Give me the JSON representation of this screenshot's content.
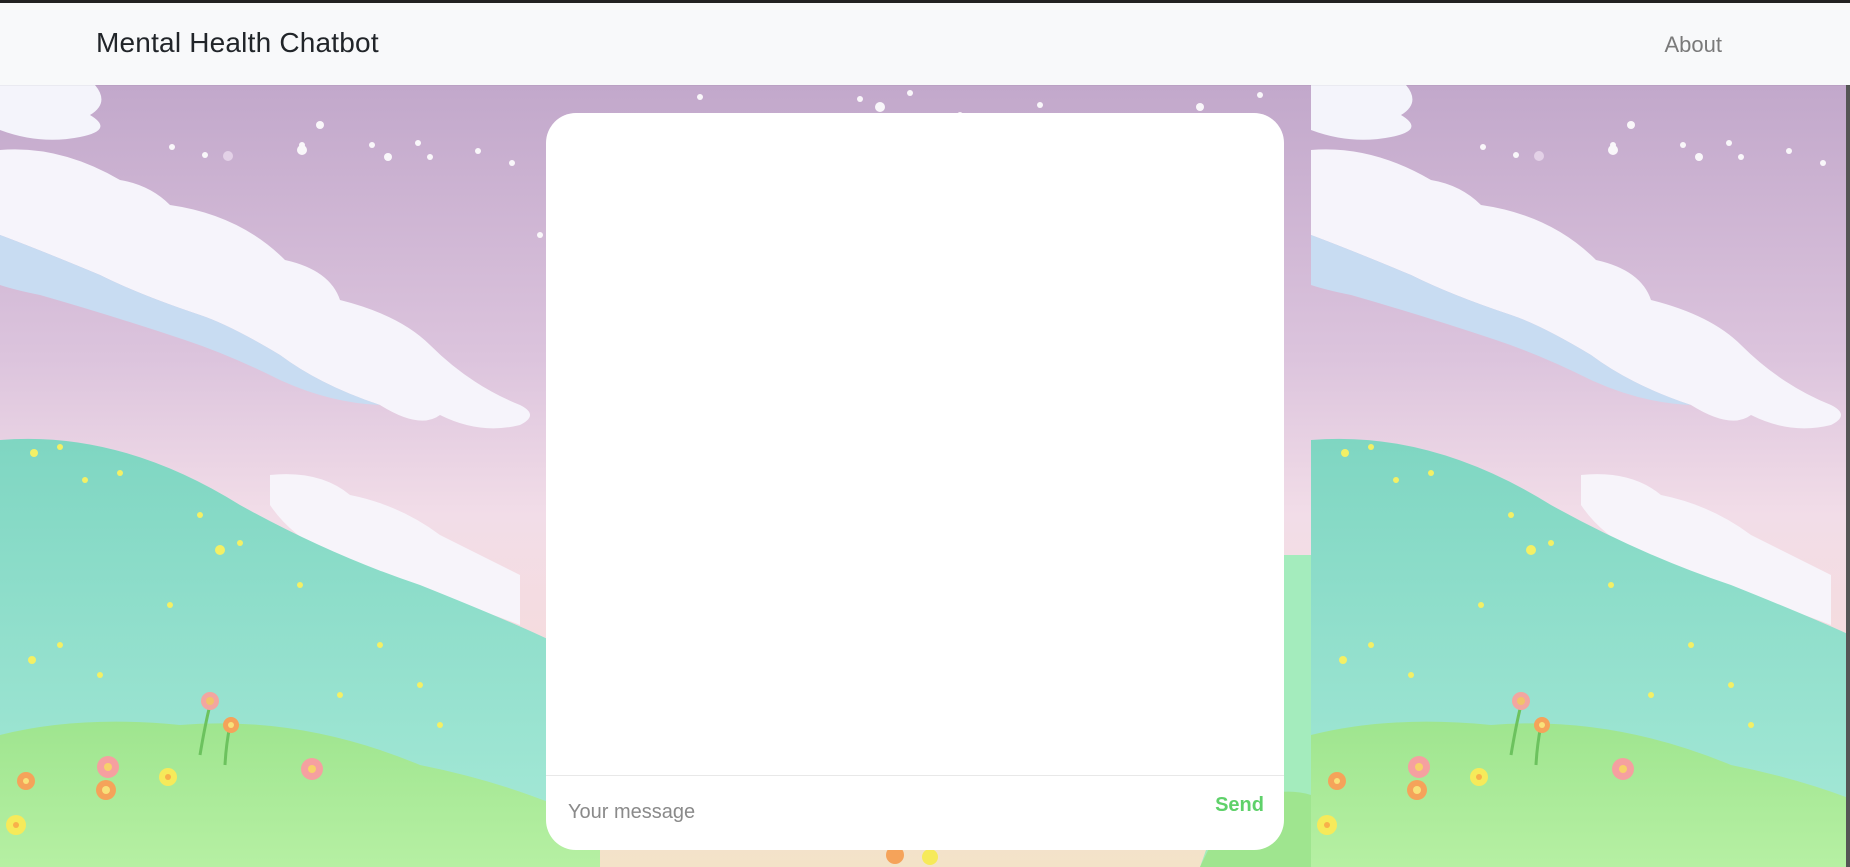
{
  "navbar": {
    "brand": "Mental Health Chatbot",
    "about_link": "About"
  },
  "chat": {
    "input_placeholder": "Your message",
    "input_value": "",
    "send_label": "Send",
    "send_color": "#5fd16a"
  },
  "colors": {
    "navbar_bg": "#f8f9fa",
    "sky_top": "#c4a9cc",
    "sky_bottom": "#f6dde2",
    "hill_teal": "#8edcc8",
    "grass": "#9ee88f"
  }
}
